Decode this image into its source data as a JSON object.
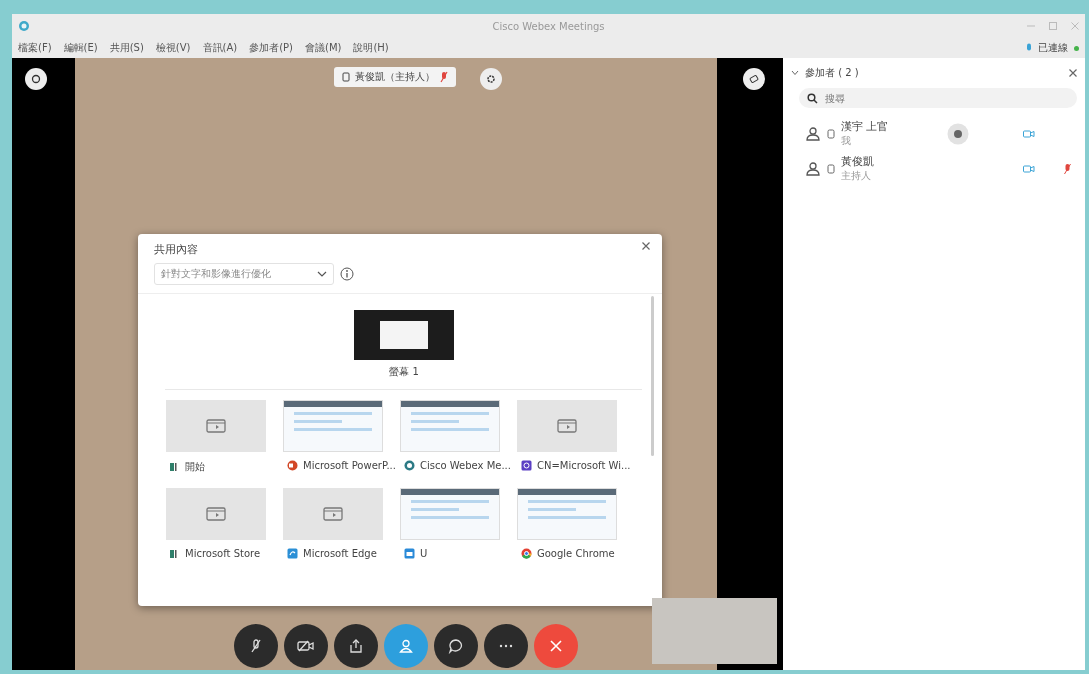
{
  "window": {
    "title": "Cisco Webex Meetings"
  },
  "menu": [
    "檔案(F)",
    "編輯(E)",
    "共用(S)",
    "檢視(V)",
    "音訊(A)",
    "參加者(P)",
    "會議(M)",
    "說明(H)"
  ],
  "connection": {
    "status": "已連線",
    "connected": true
  },
  "video": {
    "speaker_label": "黃俊凱（主持人）",
    "speaker_muted": true
  },
  "share_dialog": {
    "title": "共用內容",
    "optimize_dropdown": "針對文字和影像進行優化",
    "screen": {
      "label": "螢幕 1"
    },
    "apps": [
      {
        "label": "開始",
        "kind": "windows"
      },
      {
        "label": "Microsoft PowerP...",
        "kind": "powerpoint"
      },
      {
        "label": "Cisco Webex Me...",
        "kind": "webex"
      },
      {
        "label": "CN=Microsoft Wi...",
        "kind": "generic"
      },
      {
        "label": "Microsoft Store",
        "kind": "windows"
      },
      {
        "label": "Microsoft Edge",
        "kind": "edge"
      },
      {
        "label": "U",
        "kind": "folder"
      },
      {
        "label": "Google Chrome",
        "kind": "chrome"
      }
    ]
  },
  "controls": [
    {
      "kind": "mute",
      "selected": false
    },
    {
      "kind": "video",
      "selected": false
    },
    {
      "kind": "share",
      "selected": false
    },
    {
      "kind": "participants",
      "selected": true
    },
    {
      "kind": "chat",
      "selected": false
    },
    {
      "kind": "more",
      "selected": false
    },
    {
      "kind": "leave",
      "selected": false
    }
  ],
  "participants_panel": {
    "title": "參加者 ( 2 )",
    "search": {
      "placeholder": "搜尋"
    },
    "participants": [
      {
        "name": "漢宇 上官",
        "role": "我",
        "sharing": true,
        "muted": false
      },
      {
        "name": "黃俊凱",
        "role": "主持人",
        "sharing": false,
        "muted": true
      }
    ]
  }
}
